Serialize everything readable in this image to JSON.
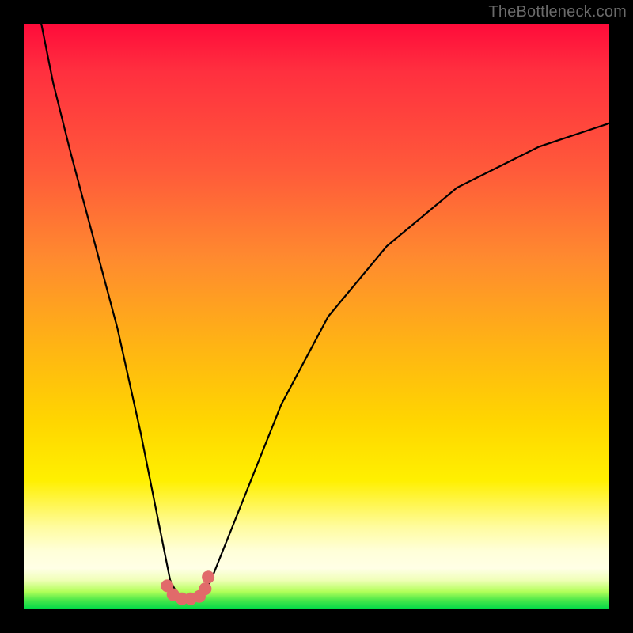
{
  "watermark": "TheBottleneck.com",
  "chart_data": {
    "type": "line",
    "title": "",
    "xlabel": "",
    "ylabel": "",
    "xlim": [
      0,
      100
    ],
    "ylim": [
      0,
      100
    ],
    "series": [
      {
        "name": "bottleneck-curve",
        "x": [
          3,
          5,
          8,
          12,
          16,
          20,
          22,
          24,
          25,
          26,
          27,
          28,
          29,
          30,
          31,
          32,
          34,
          38,
          44,
          52,
          62,
          74,
          88,
          100
        ],
        "values": [
          100,
          90,
          78,
          63,
          48,
          30,
          20,
          10,
          5,
          3,
          2,
          1.5,
          1.5,
          2,
          3,
          5,
          10,
          20,
          35,
          50,
          62,
          72,
          79,
          83
        ]
      }
    ],
    "markers": {
      "name": "bottleneck-minimum-dots",
      "color": "#e16a6a",
      "radius_px": 8,
      "x": [
        24.5,
        25.5,
        27,
        28.5,
        30,
        31,
        31.5
      ],
      "values": [
        4.0,
        2.5,
        1.8,
        1.8,
        2.2,
        3.5,
        5.5
      ]
    },
    "gradient_stops": [
      {
        "pos": 0.0,
        "color": "#ff0b3a"
      },
      {
        "pos": 0.4,
        "color": "#ff8a2f"
      },
      {
        "pos": 0.78,
        "color": "#fff000"
      },
      {
        "pos": 0.95,
        "color": "#f0ffb8"
      },
      {
        "pos": 1.0,
        "color": "#00d948"
      }
    ]
  }
}
